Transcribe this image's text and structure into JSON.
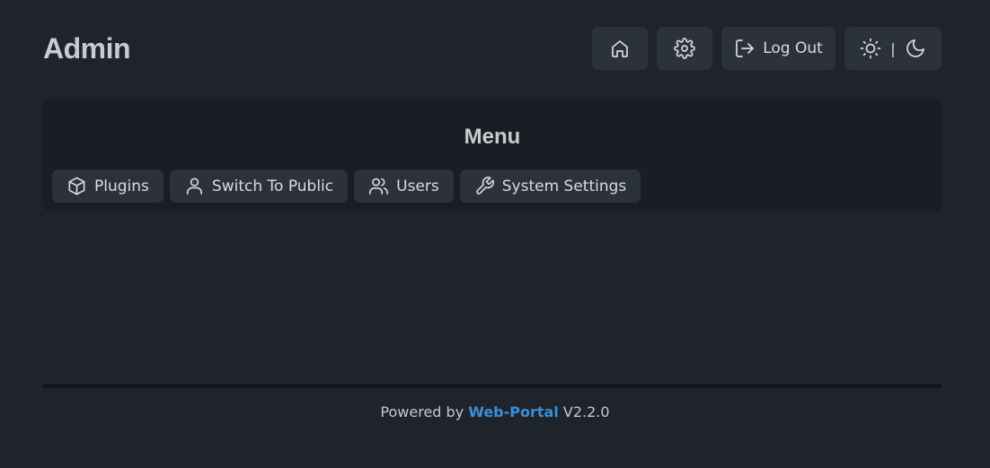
{
  "header": {
    "title": "Admin",
    "buttons": {
      "home_icon": "home-icon",
      "settings_icon": "gear-icon",
      "logout_label": "Log Out",
      "theme_separator": "|"
    }
  },
  "menu": {
    "title": "Menu",
    "items": [
      {
        "label": "Plugins",
        "icon": "box-icon"
      },
      {
        "label": "Switch To Public",
        "icon": "user-icon"
      },
      {
        "label": "Users",
        "icon": "users-icon"
      },
      {
        "label": "System Settings",
        "icon": "wrench-icon"
      }
    ]
  },
  "footer": {
    "prefix": "Powered by",
    "link": "Web-Portal",
    "version": "V2.2.0"
  },
  "colors": {
    "background": "#1e232c",
    "card": "#191d24",
    "button": "#2c323c",
    "link": "#3a8fd6"
  }
}
